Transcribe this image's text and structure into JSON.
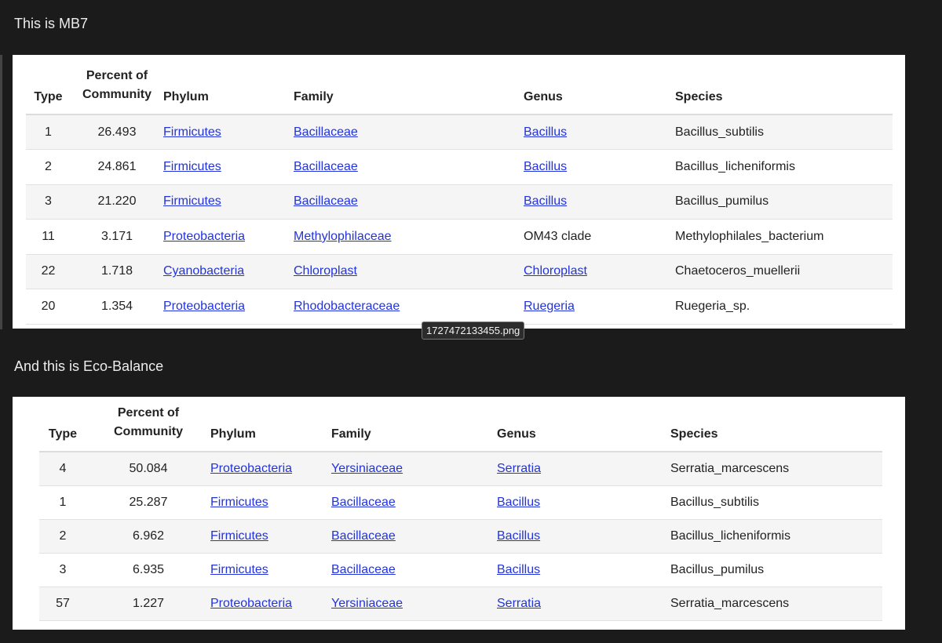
{
  "post": {
    "line1": "This is MB7",
    "line2": "And this is Eco-Balance"
  },
  "tooltip": "1727472133455.png",
  "headers": {
    "type": "Type",
    "pct_line1": "Percent of",
    "pct_line2": "Community",
    "phylum": "Phylum",
    "family": "Family",
    "genus": "Genus",
    "species": "Species"
  },
  "mb7": {
    "rows": [
      {
        "type": "1",
        "pct": "26.493",
        "phylum": "Firmicutes",
        "family": "Bacillaceae",
        "genus": "Bacillus",
        "species": "Bacillus_subtilis"
      },
      {
        "type": "2",
        "pct": "24.861",
        "phylum": "Firmicutes",
        "family": "Bacillaceae",
        "genus": "Bacillus",
        "species": "Bacillus_licheniformis"
      },
      {
        "type": "3",
        "pct": "21.220",
        "phylum": "Firmicutes",
        "family": "Bacillaceae",
        "genus": "Bacillus",
        "species": "Bacillus_pumilus"
      },
      {
        "type": "11",
        "pct": "3.171",
        "phylum": "Proteobacteria",
        "family": "Methylophilaceae",
        "genus": "OM43 clade",
        "species": "Methylophilales_bacterium"
      },
      {
        "type": "22",
        "pct": "1.718",
        "phylum": "Cyanobacteria",
        "family": "Chloroplast",
        "genus": "Chloroplast",
        "species": "Chaetoceros_muellerii"
      },
      {
        "type": "20",
        "pct": "1.354",
        "phylum": "Proteobacteria",
        "family": "Rhodobacteraceae",
        "genus": "Ruegeria",
        "species": "Ruegeria_sp."
      }
    ]
  },
  "eco": {
    "rows": [
      {
        "type": "4",
        "pct": "50.084",
        "phylum": "Proteobacteria",
        "family": "Yersiniaceae",
        "genus": "Serratia",
        "species": "Serratia_marcescens"
      },
      {
        "type": "1",
        "pct": "25.287",
        "phylum": "Firmicutes",
        "family": "Bacillaceae",
        "genus": "Bacillus",
        "species": "Bacillus_subtilis"
      },
      {
        "type": "2",
        "pct": "6.962",
        "phylum": "Firmicutes",
        "family": "Bacillaceae",
        "genus": "Bacillus",
        "species": "Bacillus_licheniformis"
      },
      {
        "type": "3",
        "pct": "6.935",
        "phylum": "Firmicutes",
        "family": "Bacillaceae",
        "genus": "Bacillus",
        "species": "Bacillus_pumilus"
      },
      {
        "type": "57",
        "pct": "1.227",
        "phylum": "Proteobacteria",
        "family": "Yersiniaceae",
        "genus": "Serratia",
        "species": "Serratia_marcescens"
      }
    ]
  }
}
